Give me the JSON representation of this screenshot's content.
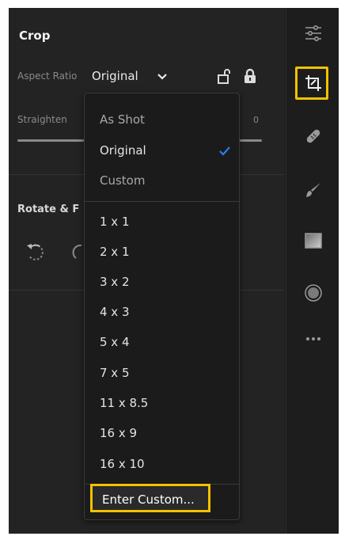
{
  "panel": {
    "title": "Crop",
    "aspect_ratio_label": "Aspect Ratio",
    "aspect_ratio_value": "Original",
    "straighten_label": "Straighten",
    "straighten_value": "0",
    "rotate_label": "Rotate & F"
  },
  "dropdown": {
    "group1": [
      "As Shot",
      "Original",
      "Custom"
    ],
    "selected": "Original",
    "group2": [
      "1 x 1",
      "2 x 1",
      "3 x 2",
      "4 x 3",
      "5 x 4",
      "7 x 5",
      "11 x 8.5",
      "16 x 9",
      "16 x 10"
    ],
    "enter_custom": "Enter Custom..."
  },
  "rail": {
    "icons": [
      "sliders-icon",
      "crop-icon",
      "bandage-icon",
      "brush-icon",
      "gradient-icon",
      "radial-icon",
      "more-icon"
    ],
    "active": "crop-icon"
  },
  "colors": {
    "highlight": "#f2c200",
    "check": "#2680eb",
    "background": "#232323"
  }
}
